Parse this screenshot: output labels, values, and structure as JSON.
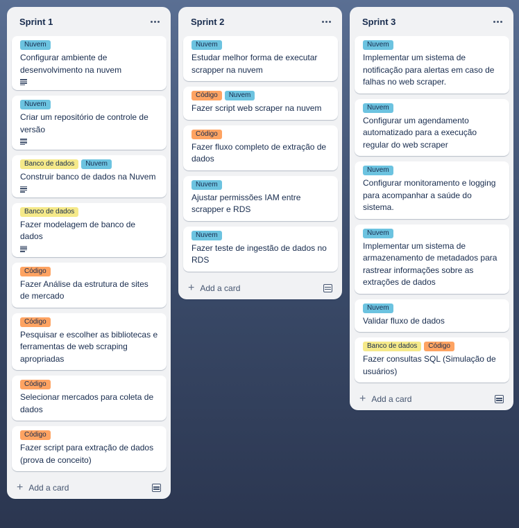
{
  "colors": {
    "Nuvem": "#6cc3e0",
    "Código": "#fea362",
    "Banco de dados": "#f5e989"
  },
  "lists": [
    {
      "title": "Sprint 1",
      "add_label": "Add a card",
      "cards": [
        {
          "labels": [
            "Nuvem"
          ],
          "title": "Configurar ambiente de desenvolvimento na nuvem",
          "has_description": true
        },
        {
          "labels": [
            "Nuvem"
          ],
          "title": "Criar um repositório de controle de versão",
          "has_description": true
        },
        {
          "labels": [
            "Banco de dados",
            "Nuvem"
          ],
          "title": "Construir banco de dados na Nuvem",
          "has_description": true
        },
        {
          "labels": [
            "Banco de dados"
          ],
          "title": "Fazer modelagem de banco de dados",
          "has_description": true
        },
        {
          "labels": [
            "Código"
          ],
          "title": "Fazer Análise da estrutura de sites de mercado",
          "has_description": false
        },
        {
          "labels": [
            "Código"
          ],
          "title": "Pesquisar e escolher as bibliotecas e ferramentas de web scraping apropriadas",
          "has_description": false
        },
        {
          "labels": [
            "Código"
          ],
          "title": "Selecionar mercados para coleta de dados",
          "has_description": false
        },
        {
          "labels": [
            "Código"
          ],
          "title": "Fazer script para extração de dados (prova de conceito)",
          "has_description": false
        }
      ]
    },
    {
      "title": "Sprint 2",
      "add_label": "Add a card",
      "cards": [
        {
          "labels": [
            "Nuvem"
          ],
          "title": "Estudar melhor forma de executar scrapper na nuvem",
          "has_description": false
        },
        {
          "labels": [
            "Código",
            "Nuvem"
          ],
          "title": "Fazer script web scraper na nuvem",
          "has_description": false
        },
        {
          "labels": [
            "Código"
          ],
          "title": "Fazer fluxo completo de extração de dados",
          "has_description": false
        },
        {
          "labels": [
            "Nuvem"
          ],
          "title": "Ajustar permissões IAM entre scrapper e RDS",
          "has_description": false
        },
        {
          "labels": [
            "Nuvem"
          ],
          "title": "Fazer teste de ingestão de dados no RDS",
          "has_description": false
        }
      ]
    },
    {
      "title": "Sprint 3",
      "add_label": "Add a card",
      "cards": [
        {
          "labels": [
            "Nuvem"
          ],
          "title": "Implementar um sistema de notificação para alertas em caso de falhas no web scraper.",
          "has_description": false
        },
        {
          "labels": [
            "Nuvem"
          ],
          "title": "Configurar um agendamento automatizado para a execução regular do web scraper",
          "has_description": false
        },
        {
          "labels": [
            "Nuvem"
          ],
          "title": "Configurar monitoramento e logging para acompanhar a saúde do sistema.",
          "has_description": false
        },
        {
          "labels": [
            "Nuvem"
          ],
          "title": "Implementar um sistema de armazenamento de metadados para rastrear informações sobre as extrações de dados",
          "has_description": false
        },
        {
          "labels": [
            "Nuvem"
          ],
          "title": "Validar fluxo de dados",
          "has_description": false
        },
        {
          "labels": [
            "Banco de dados",
            "Código"
          ],
          "title": "Fazer consultas SQL (Simulação de usuários)",
          "has_description": false
        }
      ]
    }
  ]
}
